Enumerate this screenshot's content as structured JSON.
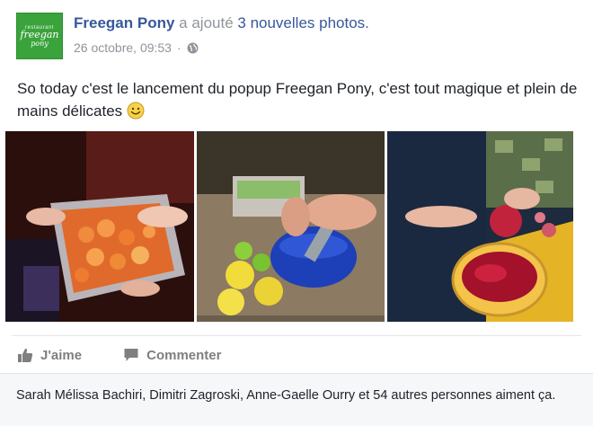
{
  "post": {
    "author": "Freegan Pony",
    "verb": "a ajouté",
    "photos_link": "3 nouvelles photos.",
    "timestamp": "26 octobre, 09:53",
    "separator": "·",
    "privacy_icon": "globe-icon",
    "text": "So today c'est le lancement du popup Freegan Pony, c'est tout magique et plein de mains délicates",
    "emoji": "smile-emoji",
    "avatar_logo": {
      "small": "restaurant",
      "line1": "freegan",
      "line2": "pony"
    }
  },
  "photos": [
    {
      "name": "photo-food-tray-peaches"
    },
    {
      "name": "photo-limes-lemons-grater"
    },
    {
      "name": "photo-pomegranate-bowl"
    }
  ],
  "actions": {
    "like_label": "J'aime",
    "comment_label": "Commenter"
  },
  "likes": {
    "summary": "Sarah Mélissa Bachiri, Dimitri Zagroski, Anne-Gaelle Ourry et 54 autres personnes aiment ça."
  },
  "colors": {
    "link": "#365899",
    "avatar_green": "#3aa33c",
    "muted": "#90949c",
    "action_gray": "#7f7f7f"
  }
}
